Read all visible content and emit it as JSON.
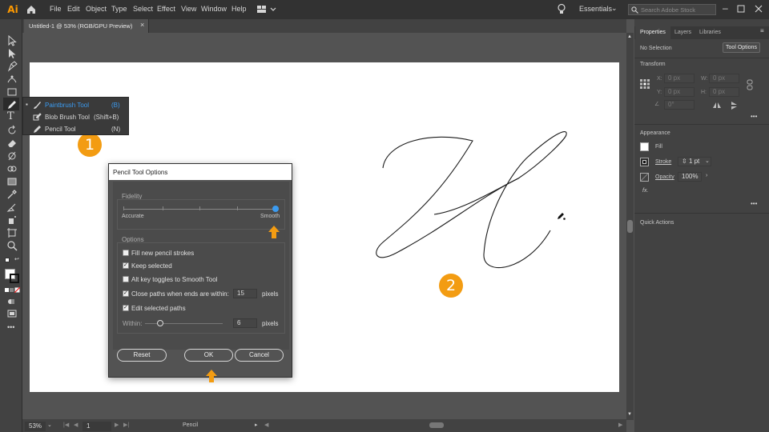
{
  "app": {
    "logo": "Ai"
  },
  "menubar": {
    "items": [
      "File",
      "Edit",
      "Object",
      "Type",
      "Select",
      "Effect",
      "View",
      "Window",
      "Help"
    ],
    "workspace": "Essentials",
    "search_placeholder": "Search Adobe Stock"
  },
  "document": {
    "tab_title": "Untitled-1 @ 53% (RGB/GPU Preview)",
    "close": "×"
  },
  "flyout": {
    "items": [
      {
        "label": "Paintbrush Tool",
        "shortcut": "(B)",
        "icon": "paintbrush-icon"
      },
      {
        "label": "Blob Brush Tool",
        "shortcut": "(Shift+B)",
        "icon": "blob-brush-icon"
      },
      {
        "label": "Pencil Tool",
        "shortcut": "(N)",
        "icon": "pencil-icon"
      }
    ]
  },
  "dialog": {
    "title": "Pencil Tool Options",
    "fidelity_label": "Fidelity",
    "fidelity_left": "Accurate",
    "fidelity_right": "Smooth",
    "fidelity_value": 1.0,
    "options_label": "Options",
    "opt_fill": "Fill new pencil strokes",
    "opt_fill_checked": false,
    "opt_keep": "Keep selected",
    "opt_keep_checked": true,
    "opt_alt": "Alt key toggles to Smooth Tool",
    "opt_alt_checked": false,
    "opt_close": "Close paths when ends are within:",
    "opt_close_checked": true,
    "close_value": "15",
    "close_unit": "pixels",
    "opt_edit": "Edit selected paths",
    "opt_edit_checked": true,
    "within_label": "Within:",
    "within_value": "6",
    "within_unit": "pixels",
    "within_slider": 0.2,
    "reset": "Reset",
    "ok": "OK",
    "cancel": "Cancel"
  },
  "badges": {
    "one": "1",
    "two": "2"
  },
  "panel": {
    "tabs": [
      "Properties",
      "Layers",
      "Libraries"
    ],
    "no_selection": "No Selection",
    "tool_options": "Tool Options",
    "transform": "Transform",
    "x_label": "X:",
    "y_label": "Y:",
    "w_label": "W:",
    "h_label": "H:",
    "x_val": "0 px",
    "y_val": "0 px",
    "w_val": "0 px",
    "h_val": "0 px",
    "angle_val": "0°",
    "appearance": "Appearance",
    "fill": "Fill",
    "stroke": "Stroke",
    "stroke_val": "1 pt",
    "opacity": "Opacity",
    "opacity_val": "100%",
    "fx": "fx.",
    "more": "•••",
    "quick_actions": "Quick Actions"
  },
  "status": {
    "zoom": "53%",
    "artboard_num": "1",
    "tool": "Pencil"
  },
  "colors": {
    "accent": "#2d8ceb",
    "badge": "#f39c12",
    "arrow": "#f39c12"
  }
}
